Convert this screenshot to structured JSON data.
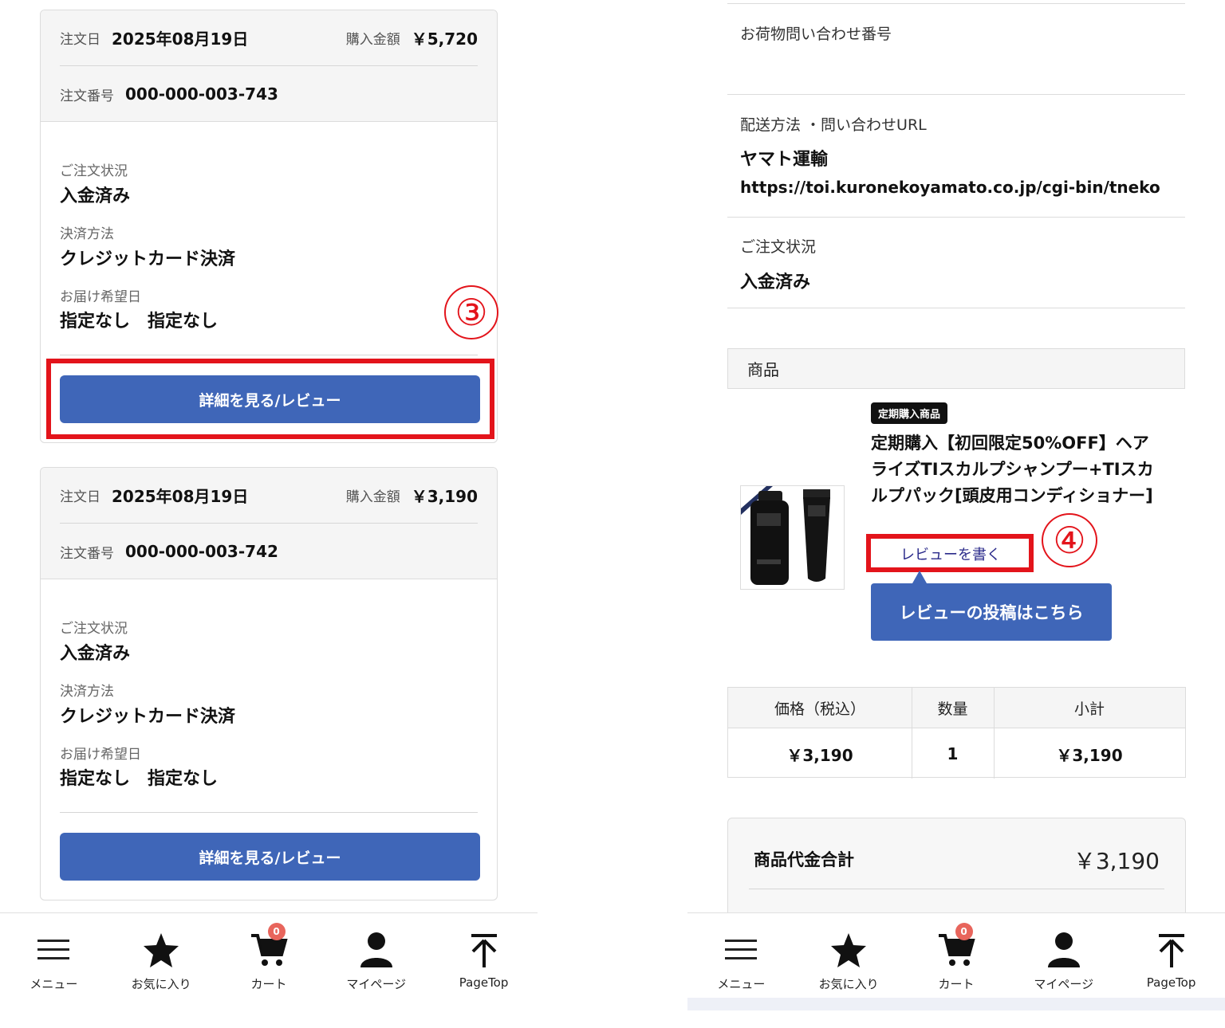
{
  "orders": [
    {
      "date_label": "注文日",
      "date": "2025年08月19日",
      "amount_label": "購入金額",
      "amount": "￥5,720",
      "number_label": "注文番号",
      "number": "000-000-003-743",
      "status_label": "ご注文状況",
      "status": "入金済み",
      "payment_label": "決済方法",
      "payment": "クレジットカード決済",
      "delivery_label": "お届け希望日",
      "delivery": "指定なし　指定なし",
      "button": "詳細を見る/レビュー"
    },
    {
      "date_label": "注文日",
      "date": "2025年08月19日",
      "amount_label": "購入金額",
      "amount": "￥3,190",
      "number_label": "注文番号",
      "number": "000-000-003-742",
      "status_label": "ご注文状況",
      "status": "入金済み",
      "payment_label": "決済方法",
      "payment": "クレジットカード決済",
      "delivery_label": "お届け希望日",
      "delivery": "指定なし　指定なし",
      "button": "詳細を見る/レビュー"
    }
  ],
  "annotations": {
    "step3": "③",
    "step4": "④"
  },
  "nav": {
    "menu": "メニュー",
    "favorites": "お気に入り",
    "cart": "カート",
    "cart_count": "0",
    "mypage": "マイページ",
    "pagetop": "PageTop"
  },
  "detail": {
    "tracking_label": "お荷物問い合わせ番号",
    "shipping_label": "配送方法 ・問い合わせURL",
    "carrier": "ヤマト運輸",
    "tracking_url": "https://toi.kuronekoyamato.co.jp/cgi-bin/tneko",
    "status_label": "ご注文状況",
    "status": "入金済み",
    "product_header": "商品",
    "subscription_badge": "定期購入商品",
    "product_name": "定期購入【初回限定50%OFF】ヘアライズTIスカルプシャンプー+TIスカルプパック[頭皮用コンディショナー]",
    "review_link": "レビューを書く",
    "review_tooltip": "レビューの投稿はこちら",
    "table_headers": [
      "価格（税込）",
      "数量",
      "小計"
    ],
    "table_values": [
      "￥3,190",
      "1",
      "￥3,190"
    ],
    "total_label": "商品代金合計",
    "total_value": "￥3,190"
  },
  "colors": {
    "accent_blue": "#3f66b8",
    "highlight_red": "#e3141b",
    "badge_red": "#e8655c"
  }
}
